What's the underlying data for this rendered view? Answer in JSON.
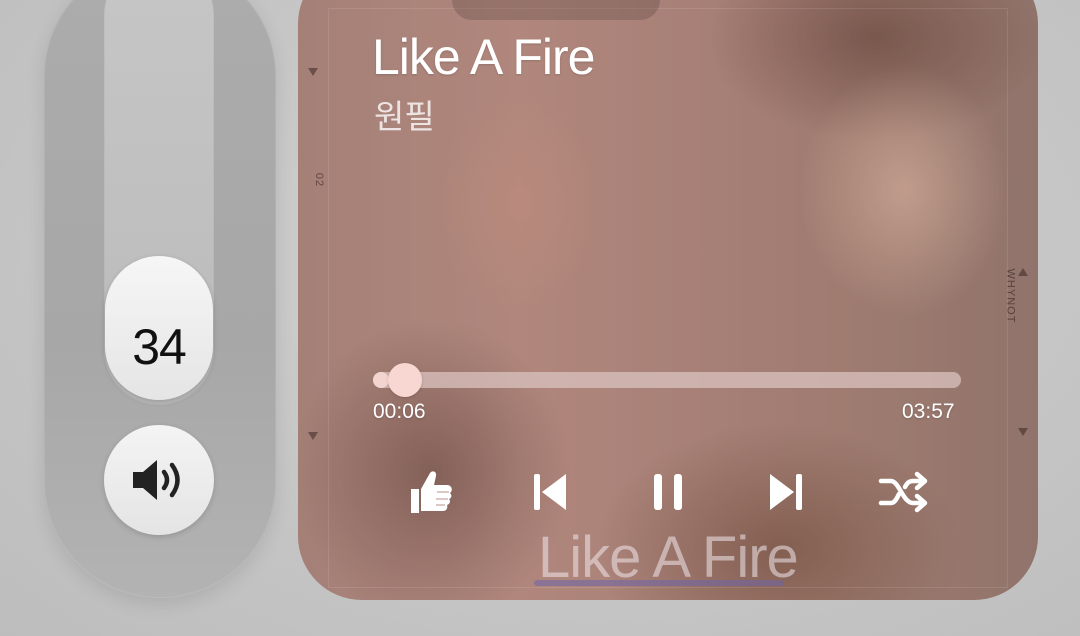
{
  "volume": {
    "value": "34",
    "level": 0.34,
    "button_icon": "speaker-volume-icon"
  },
  "player": {
    "title": "Like A Fire",
    "artist": "원필",
    "elapsed": "00:06",
    "total": "03:57",
    "progress": 0.025,
    "controls": [
      {
        "name": "like",
        "icon": "thumbs-up-icon"
      },
      {
        "name": "previous",
        "icon": "skip-previous-icon"
      },
      {
        "name": "pause",
        "icon": "pause-icon"
      },
      {
        "name": "next",
        "icon": "skip-next-icon"
      },
      {
        "name": "shuffle",
        "icon": "shuffle-icon"
      }
    ],
    "artwork": {
      "caption": "Like A Fire",
      "side_left": "02",
      "side_right": "WHYNOT"
    }
  }
}
